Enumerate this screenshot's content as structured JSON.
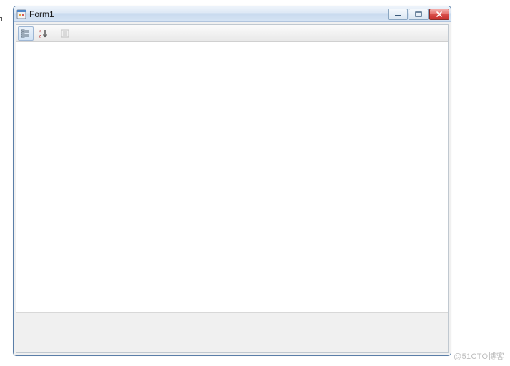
{
  "window": {
    "title": "Form1"
  },
  "toolbar": {
    "categorized_tip": "Categorized",
    "alphabetical_tip": "Alphabetical",
    "property_pages_tip": "Property Pages"
  },
  "watermark": "@51CTO博客"
}
